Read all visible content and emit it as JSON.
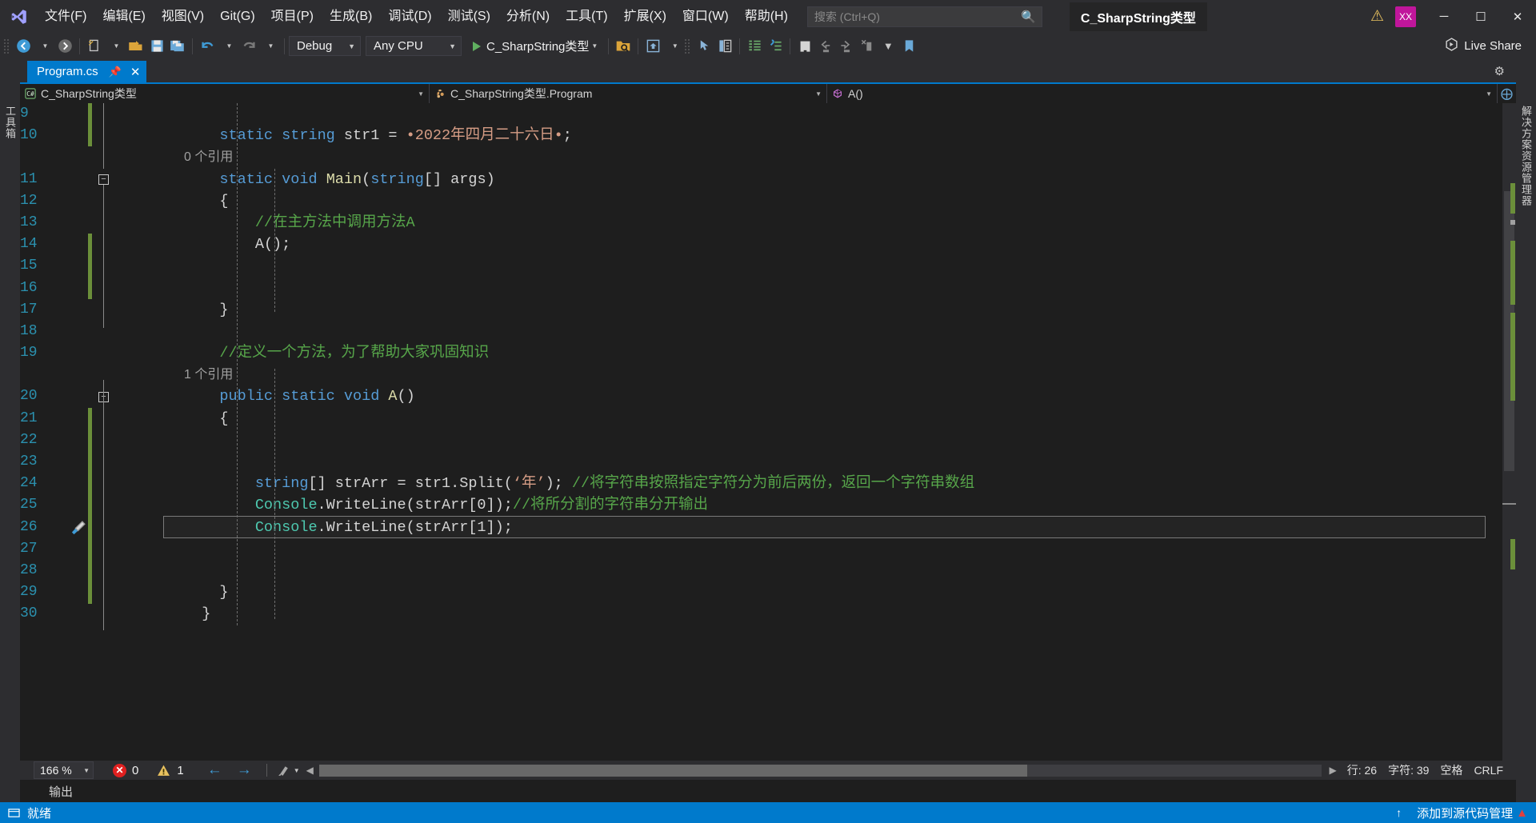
{
  "app": {
    "project_title": "C_SharpString类型",
    "avatar_initials": "XX"
  },
  "menu": {
    "items": [
      {
        "label": "文件(F)"
      },
      {
        "label": "编辑(E)"
      },
      {
        "label": "视图(V)"
      },
      {
        "label": "Git(G)"
      },
      {
        "label": "项目(P)"
      },
      {
        "label": "生成(B)"
      },
      {
        "label": "调试(D)"
      },
      {
        "label": "测试(S)"
      },
      {
        "label": "分析(N)"
      },
      {
        "label": "工具(T)"
      },
      {
        "label": "扩展(X)"
      },
      {
        "label": "窗口(W)"
      },
      {
        "label": "帮助(H)"
      }
    ]
  },
  "search": {
    "placeholder": "搜索 (Ctrl+Q)",
    "value": "",
    "icon": "search-icon"
  },
  "window_controls": {
    "minimize": "─",
    "maximize": "☐",
    "close": "✕",
    "warning_icon": "warning-triangle-icon"
  },
  "toolbar": {
    "config_combo": "Debug",
    "platform_combo": "Any CPU",
    "run_label": "C_SharpString类型",
    "live_share": "Live Share",
    "live_share_icon": "live-share-icon"
  },
  "tabs": [
    {
      "label": "Program.cs",
      "pin": "pin-icon",
      "close": "✕",
      "active": true
    }
  ],
  "navbar": {
    "project": "C_SharpString类型",
    "type": "C_SharpString类型.Program",
    "member": "A()",
    "project_icon": "csharp-file-icon",
    "type_icon": "class-icon",
    "member_icon": "method-icon"
  },
  "left_rail": {
    "label": "工具箱"
  },
  "right_rail": {
    "label": "解决方案资源管理器"
  },
  "editor": {
    "first_visible_line": 9,
    "lines": [
      {
        "n": 9,
        "tokens": [],
        "green": true
      },
      {
        "n": 10,
        "tokens": [
          {
            "t": "    ",
            "c": "punc"
          },
          {
            "t": "static",
            "c": "kw"
          },
          {
            "t": " ",
            "c": "punc"
          },
          {
            "t": "string",
            "c": "kw"
          },
          {
            "t": " ",
            "c": "punc"
          },
          {
            "t": "str1",
            "c": "punc"
          },
          {
            "t": " = ",
            "c": "punc"
          },
          {
            "t": "•2022年四月二十六日•",
            "c": "str"
          },
          {
            "t": ";",
            "c": "punc"
          }
        ],
        "green": true
      },
      {
        "n": null,
        "ref": "0 个引用"
      },
      {
        "n": 11,
        "tokens": [
          {
            "t": "    ",
            "c": "punc"
          },
          {
            "t": "static",
            "c": "kw"
          },
          {
            "t": " ",
            "c": "punc"
          },
          {
            "t": "void",
            "c": "kw"
          },
          {
            "t": " ",
            "c": "punc"
          },
          {
            "t": "Main",
            "c": "fn"
          },
          {
            "t": "(",
            "c": "punc"
          },
          {
            "t": "string",
            "c": "kw"
          },
          {
            "t": "[] ",
            "c": "punc"
          },
          {
            "t": "args",
            "c": "punc"
          },
          {
            "t": ")",
            "c": "punc"
          }
        ],
        "fold": true
      },
      {
        "n": 12,
        "tokens": [
          {
            "t": "    {",
            "c": "punc"
          }
        ]
      },
      {
        "n": 13,
        "tokens": [
          {
            "t": "        ",
            "c": "punc"
          },
          {
            "t": "//在主方法中调用方法A",
            "c": "cmt"
          }
        ]
      },
      {
        "n": 14,
        "tokens": [
          {
            "t": "        ",
            "c": "punc"
          },
          {
            "t": "A",
            "c": "punc"
          },
          {
            "t": "();",
            "c": "punc"
          }
        ],
        "green": true
      },
      {
        "n": 15,
        "tokens": [],
        "green": true
      },
      {
        "n": 16,
        "tokens": [],
        "green": true
      },
      {
        "n": 17,
        "tokens": [
          {
            "t": "    }",
            "c": "punc"
          }
        ]
      },
      {
        "n": 18,
        "tokens": []
      },
      {
        "n": 19,
        "tokens": [
          {
            "t": "    ",
            "c": "punc"
          },
          {
            "t": "//定义一个方法，为了帮助大家巩固知识",
            "c": "cmt"
          }
        ]
      },
      {
        "n": null,
        "ref": "1 个引用"
      },
      {
        "n": 20,
        "tokens": [
          {
            "t": "    ",
            "c": "punc"
          },
          {
            "t": "public",
            "c": "kw"
          },
          {
            "t": " ",
            "c": "punc"
          },
          {
            "t": "static",
            "c": "kw"
          },
          {
            "t": " ",
            "c": "punc"
          },
          {
            "t": "void",
            "c": "kw"
          },
          {
            "t": " ",
            "c": "punc"
          },
          {
            "t": "A",
            "c": "fn"
          },
          {
            "t": "()",
            "c": "punc"
          }
        ],
        "fold": true
      },
      {
        "n": 21,
        "tokens": [
          {
            "t": "    {",
            "c": "punc"
          }
        ],
        "green": true
      },
      {
        "n": 22,
        "tokens": [],
        "green": true
      },
      {
        "n": 23,
        "tokens": [],
        "green": true
      },
      {
        "n": 24,
        "tokens": [
          {
            "t": "        ",
            "c": "punc"
          },
          {
            "t": "string",
            "c": "kw"
          },
          {
            "t": "[] ",
            "c": "punc"
          },
          {
            "t": "strArr",
            "c": "punc"
          },
          {
            "t": " = ",
            "c": "punc"
          },
          {
            "t": "str1",
            "c": "punc"
          },
          {
            "t": ".",
            "c": "punc"
          },
          {
            "t": "Split",
            "c": "punc"
          },
          {
            "t": "(",
            "c": "punc"
          },
          {
            "t": "‘年’",
            "c": "str"
          },
          {
            "t": "); ",
            "c": "punc"
          },
          {
            "t": "//将字符串按照指定字符分为前后两份，返回一个字符串数组",
            "c": "cmt"
          }
        ],
        "green": true
      },
      {
        "n": 25,
        "tokens": [
          {
            "t": "        ",
            "c": "punc"
          },
          {
            "t": "Console",
            "c": "typ"
          },
          {
            "t": ".",
            "c": "punc"
          },
          {
            "t": "WriteLine",
            "c": "punc"
          },
          {
            "t": "(",
            "c": "punc"
          },
          {
            "t": "strArr",
            "c": "punc"
          },
          {
            "t": "[",
            "c": "punc"
          },
          {
            "t": "0",
            "c": "punc"
          },
          {
            "t": "]);",
            "c": "punc"
          },
          {
            "t": "//将所分割的字符串分开输出",
            "c": "cmt"
          }
        ],
        "green": true
      },
      {
        "n": 26,
        "tokens": [
          {
            "t": "        ",
            "c": "punc"
          },
          {
            "t": "Console",
            "c": "typ"
          },
          {
            "t": ".",
            "c": "punc"
          },
          {
            "t": "WriteLine",
            "c": "punc"
          },
          {
            "t": "(",
            "c": "punc"
          },
          {
            "t": "strArr",
            "c": "punc"
          },
          {
            "t": "[",
            "c": "punc"
          },
          {
            "t": "1",
            "c": "punc"
          },
          {
            "t": "]);",
            "c": "punc"
          }
        ],
        "green": true,
        "highlight": true,
        "brush": true
      },
      {
        "n": 27,
        "tokens": [],
        "green": true
      },
      {
        "n": 28,
        "tokens": [],
        "green": true
      },
      {
        "n": 29,
        "tokens": [
          {
            "t": "    }",
            "c": "punc"
          }
        ],
        "green": true
      },
      {
        "n": 30,
        "tokens": [
          {
            "t": "  }",
            "c": "punc"
          }
        ]
      }
    ]
  },
  "status": {
    "zoom": "166 %",
    "error_count": "0",
    "warning_count": "1",
    "ready": "就绪",
    "line_label": "行: 26",
    "char_label": "字符: 39",
    "space_label": "空格",
    "eol_label": "CRLF",
    "output_label": "输出",
    "watermark": "添加到源代码管理",
    "nav_back": "←",
    "nav_forward": "→"
  }
}
